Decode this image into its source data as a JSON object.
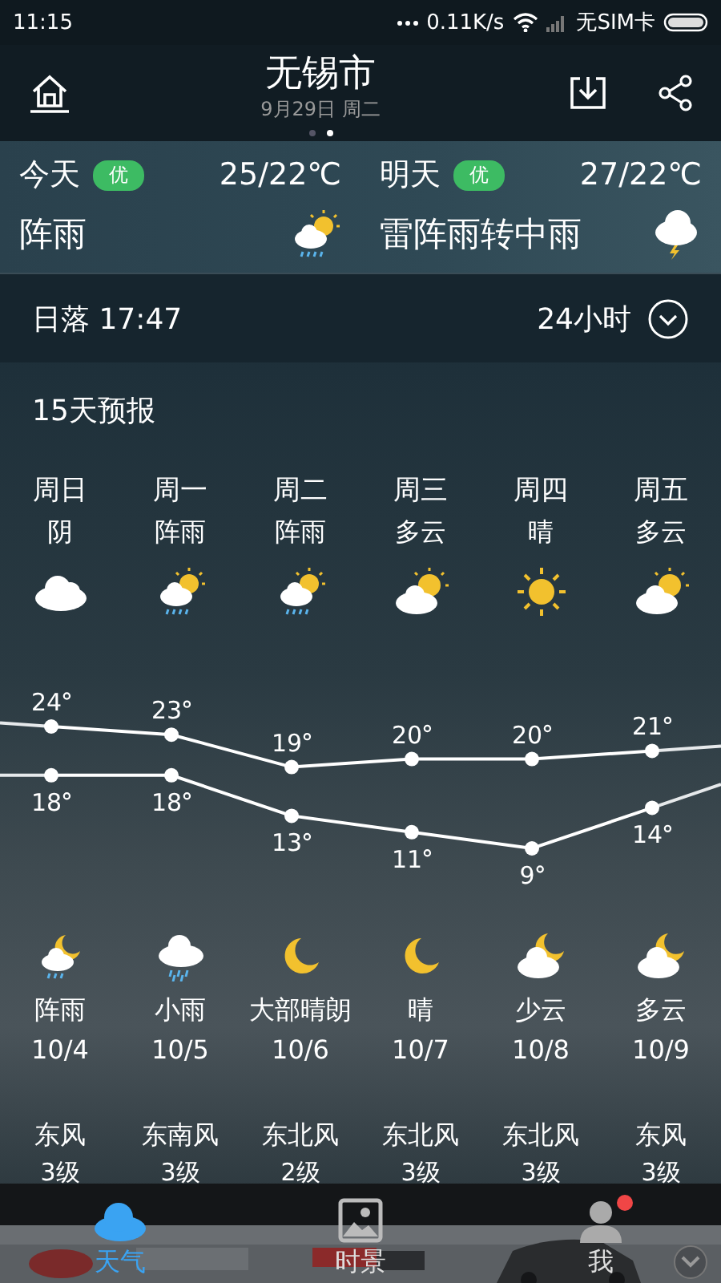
{
  "status_bar": {
    "time": "11:15",
    "network_speed": "0.11K/s",
    "carrier": "无SIM卡"
  },
  "header": {
    "city": "无锡市",
    "date": "9月29日 周二",
    "pages": [
      {
        "selected": false
      },
      {
        "selected": true
      }
    ]
  },
  "summary": [
    {
      "day": "今天",
      "aqi": "优",
      "temps": "25/22℃",
      "condition": "阵雨",
      "kind": "shower"
    },
    {
      "day": "明天",
      "aqi": "优",
      "temps": "27/22℃",
      "condition": "雷阵雨转中雨",
      "kind": "thunder"
    }
  ],
  "sunset": "日落 17:47",
  "hourly_toggle": "24小时",
  "forecast_title": "15天预报",
  "days": [
    {
      "weekday": "周日",
      "day_condition": "阴",
      "kind": "cloud",
      "night": {
        "kind": "moon-shower",
        "condition": "阵雨"
      },
      "date": "10/4",
      "wind": "东风",
      "wind_level": "3级"
    },
    {
      "weekday": "周一",
      "day_condition": "阵雨",
      "kind": "shower",
      "night": {
        "kind": "rain",
        "condition": "小雨"
      },
      "date": "10/5",
      "wind": "东南风",
      "wind_level": "3级"
    },
    {
      "weekday": "周二",
      "day_condition": "阵雨",
      "kind": "shower",
      "night": {
        "kind": "moon",
        "condition": "大部晴朗"
      },
      "date": "10/6",
      "wind": "东北风",
      "wind_level": "2级"
    },
    {
      "weekday": "周三",
      "day_condition": "多云",
      "kind": "partly",
      "night": {
        "kind": "moon",
        "condition": "晴"
      },
      "date": "10/7",
      "wind": "东北风",
      "wind_level": "3级"
    },
    {
      "weekday": "周四",
      "day_condition": "晴",
      "kind": "sun",
      "night": {
        "kind": "moon-cloud",
        "condition": "少云"
      },
      "date": "10/8",
      "wind": "东北风",
      "wind_level": "3级"
    },
    {
      "weekday": "周五",
      "day_condition": "多云",
      "kind": "partly",
      "night": {
        "kind": "moon-cloud",
        "condition": "多云"
      },
      "date": "10/9",
      "wind": "东风",
      "wind_level": "3级"
    }
  ],
  "chart_data": {
    "type": "line",
    "series": [
      {
        "color": "#ffffff",
        "values": [
          24,
          23,
          19,
          20,
          20,
          21
        ]
      },
      {
        "color": "#ffffff",
        "values": [
          18,
          18,
          13,
          11,
          9,
          14
        ]
      }
    ],
    "categories": [
      null,
      null,
      null,
      null,
      null,
      null
    ],
    "data_labels": true
  },
  "tabs": [
    {
      "label": "天气",
      "selected": true,
      "kind": "cloud",
      "badge": false
    },
    {
      "label": "时景",
      "selected": false,
      "badge": false
    },
    {
      "label": "我",
      "selected": false,
      "kind": "person",
      "badge": true
    }
  ]
}
